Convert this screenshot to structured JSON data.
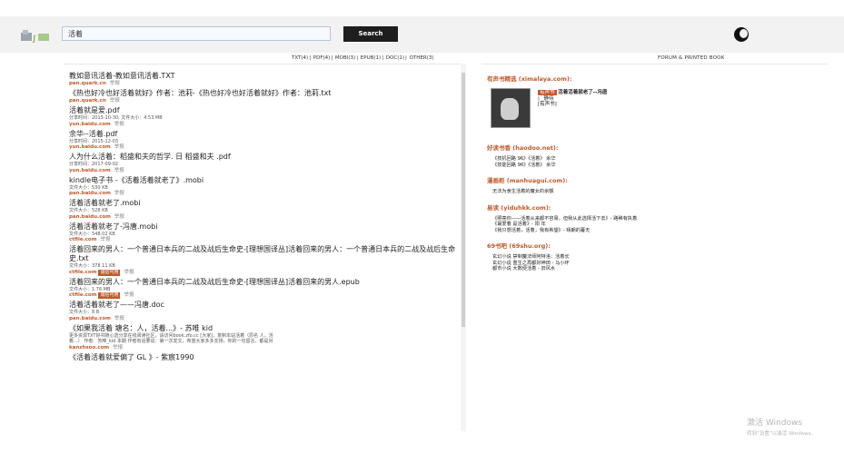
{
  "header": {
    "search_value": "活着",
    "search_button": "Search"
  },
  "filters": [
    "TXT(4)",
    "PDF(4)",
    "MOBI(3)",
    "EPUB(1)",
    "DOC(1)",
    "OTHER(3)"
  ],
  "forum_heading": "FORUM & PRINTED BOOK",
  "results": [
    {
      "title": "教如意讯活着-教如意讯活着.TXT",
      "meta": [],
      "source": "pan.quark.cn",
      "tag": "",
      "report": "举报"
    },
    {
      "title": "《热也好冷也好活着就好》作者：池莉-《热也好冷也好活着就好》作者：池莉.txt",
      "meta": [],
      "source": "pan.quark.cn",
      "tag": "",
      "report": "举报"
    },
    {
      "title": "活着就是爱.pdf",
      "meta": [
        "分享时间：2013-10-30, 文件大小：4.53 MB"
      ],
      "source": "yun.baidu.com",
      "tag": "",
      "report": "举报"
    },
    {
      "title": "余华--活着.pdf",
      "meta": [
        "分享时间：2015-12-03"
      ],
      "source": "yun.baidu.com",
      "tag": "",
      "report": "举报"
    },
    {
      "title": "人为什么活着：稻盛和夫的哲学. 日 稻盛和夫 .pdf",
      "meta": [
        "分享时间：2017-09-02"
      ],
      "source": "yun.baidu.com",
      "tag": "",
      "report": "举报"
    },
    {
      "title": "kindle电子书 -《活着活着就老了》.mobi",
      "meta": [
        "文件大小：530 KB"
      ],
      "source": "pan.baidu.com",
      "tag": "",
      "report": "举报"
    },
    {
      "title": "活着活着就老了.mobi",
      "meta": [
        "文件大小：528 KB"
      ],
      "source": "pan.baidu.com",
      "tag": "",
      "report": "举报"
    },
    {
      "title": "活着活着就老了-冯唐.mobi",
      "meta": [
        "文件大小：548.02 KB"
      ],
      "source": "ctfile.com",
      "tag": "",
      "report": "举报"
    },
    {
      "title": "活着回来的男人：一个普通日本兵的二战及战后生命史-[理想国译丛]活着回来的男人：一个普通日本兵的二战及战后生命史.txt",
      "meta": [
        "文件大小：378.11 KB"
      ],
      "source": "ctfile.com",
      "tag": "诚信可用",
      "report": "举报"
    },
    {
      "title": "活着回来的男人：一个普通日本兵的二战及战后生命史-[理想国译丛]活着回来的男人.epub",
      "meta": [
        "文件大小：1.76 MB"
      ],
      "source": "ctfile.com",
      "tag": "诚信可用",
      "report": "举报"
    },
    {
      "title": "活着活着就老了——冯唐.doc",
      "meta": [
        "文件大小：8 B"
      ],
      "source": "pan.baidu.com",
      "tag": "",
      "report": "举报"
    },
    {
      "title": "《如果我活着 塘名：人，活着...》- 苏唯 kid",
      "meta": [
        "更多资源TXT好书随心选分享在线阅读社区，请访问book.zfo.cc [大家]，复制本站活着（原名 人，活",
        "着...） 作者：苏唯_kid 本期 作者有话要说：第一次发文，希望大家多多支持，你的一句留言，都是对"
      ],
      "source": "kanzhsoo.com",
      "tag": "",
      "report": "举报"
    },
    {
      "title": "《活着活着就爱偏了 GL 》- 紫宸1990",
      "meta": [],
      "source": "",
      "tag": "",
      "report": ""
    }
  ],
  "forum": {
    "ximalaya": {
      "title": "有声书精选 (ximalaya.com):",
      "badge": "有声书",
      "book_title": "活着活着就老了--冯唐",
      "lines": [
        "| _静待",
        "[有声书]"
      ]
    },
    "haodoo": {
      "title": "好读书香 (haodoo.net):",
      "items": [
        "《技机回路 96》《活着》 余华",
        "《技能回路 96》《活着》 余华"
      ]
    },
    "manhuagui": {
      "title": "漫画柜 (manhuagui.com):",
      "items": [
        "无法为食生活着的魔女的余额"
      ]
    },
    "yiduhkk": {
      "title": "易读 (yiduhkk.com):",
      "items": [
        "《照亮你——活着从来都不容易，但我从此选择活下去》- 路稀有执着",
        "《最爱着 是活着》- 阳 年",
        "《我只想活着，活着，我有希望》- 晴朗的暮无"
      ]
    },
    "shu69": {
      "title": "69书吧 (69shu.org):",
      "items": [
        "玄幻小说 禁制魔法师阿特洛：活着长",
        "玄幻小说 重生之再都好神田 - 马小环",
        "都市小说 大数便活着 - 旧风水"
      ]
    }
  },
  "watermark": {
    "line1": "激活 Windows",
    "line2": "转到“设置”以激活 Windows。"
  }
}
